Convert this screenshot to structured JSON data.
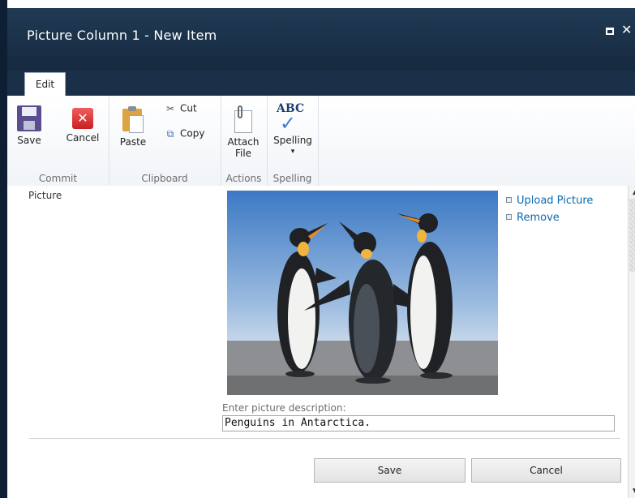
{
  "window": {
    "title": "Picture Column 1 - New Item",
    "close_glyph": "✕"
  },
  "ribbon": {
    "tab": "Edit",
    "groups": {
      "commit": {
        "label": "Commit",
        "save": "Save",
        "cancel": "Cancel"
      },
      "clipboard": {
        "label": "Clipboard",
        "paste": "Paste",
        "cut": "Cut",
        "copy": "Copy"
      },
      "actions": {
        "label": "Actions",
        "attach_line1": "Attach",
        "attach_line2": "File"
      },
      "spelling": {
        "label": "Spelling",
        "spelling": "Spelling"
      }
    },
    "icons": {
      "abc": "ABC",
      "check": "✓",
      "x": "✕",
      "cut": "✂",
      "copy": "⧉",
      "dropdown": "▾"
    }
  },
  "form": {
    "field_label": "Picture",
    "upload_link": "Upload Picture",
    "remove_link": "Remove",
    "description_label": "Enter picture description:",
    "description_value": "Penguins in Antarctica."
  },
  "buttons": {
    "save": "Save",
    "cancel": "Cancel"
  },
  "scroll": {
    "up": "▲",
    "down": "▼"
  }
}
